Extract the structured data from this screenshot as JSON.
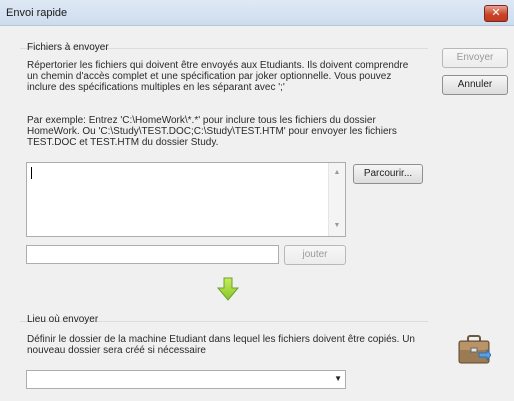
{
  "window": {
    "title": "Envoi rapide",
    "close_icon": "close-icon"
  },
  "files_group": {
    "title": "Fichiers à envoyer",
    "description": [
      "Répertorier les fichiers qui doivent être envoyés aux Etudiants. Ils doivent comprendre",
      "un chemin d'accès complet et une spécification par joker optionnelle. Vous pouvez",
      "inclure des spécifications multiples en les séparant avec ';'"
    ],
    "example": [
      "Par exemple: Entrez 'C:\\HomeWork\\*.*' pour inclure tous les fichiers du dossier",
      "HomeWork. Ou 'C:\\Study\\TEST.DOC;C:\\Study\\TEST.HTM' pour envoyer les fichiers",
      "TEST.DOC et TEST.HTM du dossier Study."
    ],
    "file_list_value": "",
    "add_input_value": "",
    "browse_label": "Parcourir...",
    "add_label": "jouter"
  },
  "buttons": {
    "send_label": "Envoyer",
    "cancel_label": "Annuler"
  },
  "arrow_icon": "green-down-arrow-icon",
  "destination_group": {
    "title": "Lieu où envoyer",
    "description": [
      "Définir le dossier de la machine Etudiant dans lequel les fichiers doivent être copiés. Un",
      "nouveau dossier sera créé si nécessaire"
    ],
    "location_value": "",
    "briefcase_icon": "briefcase-icon"
  }
}
